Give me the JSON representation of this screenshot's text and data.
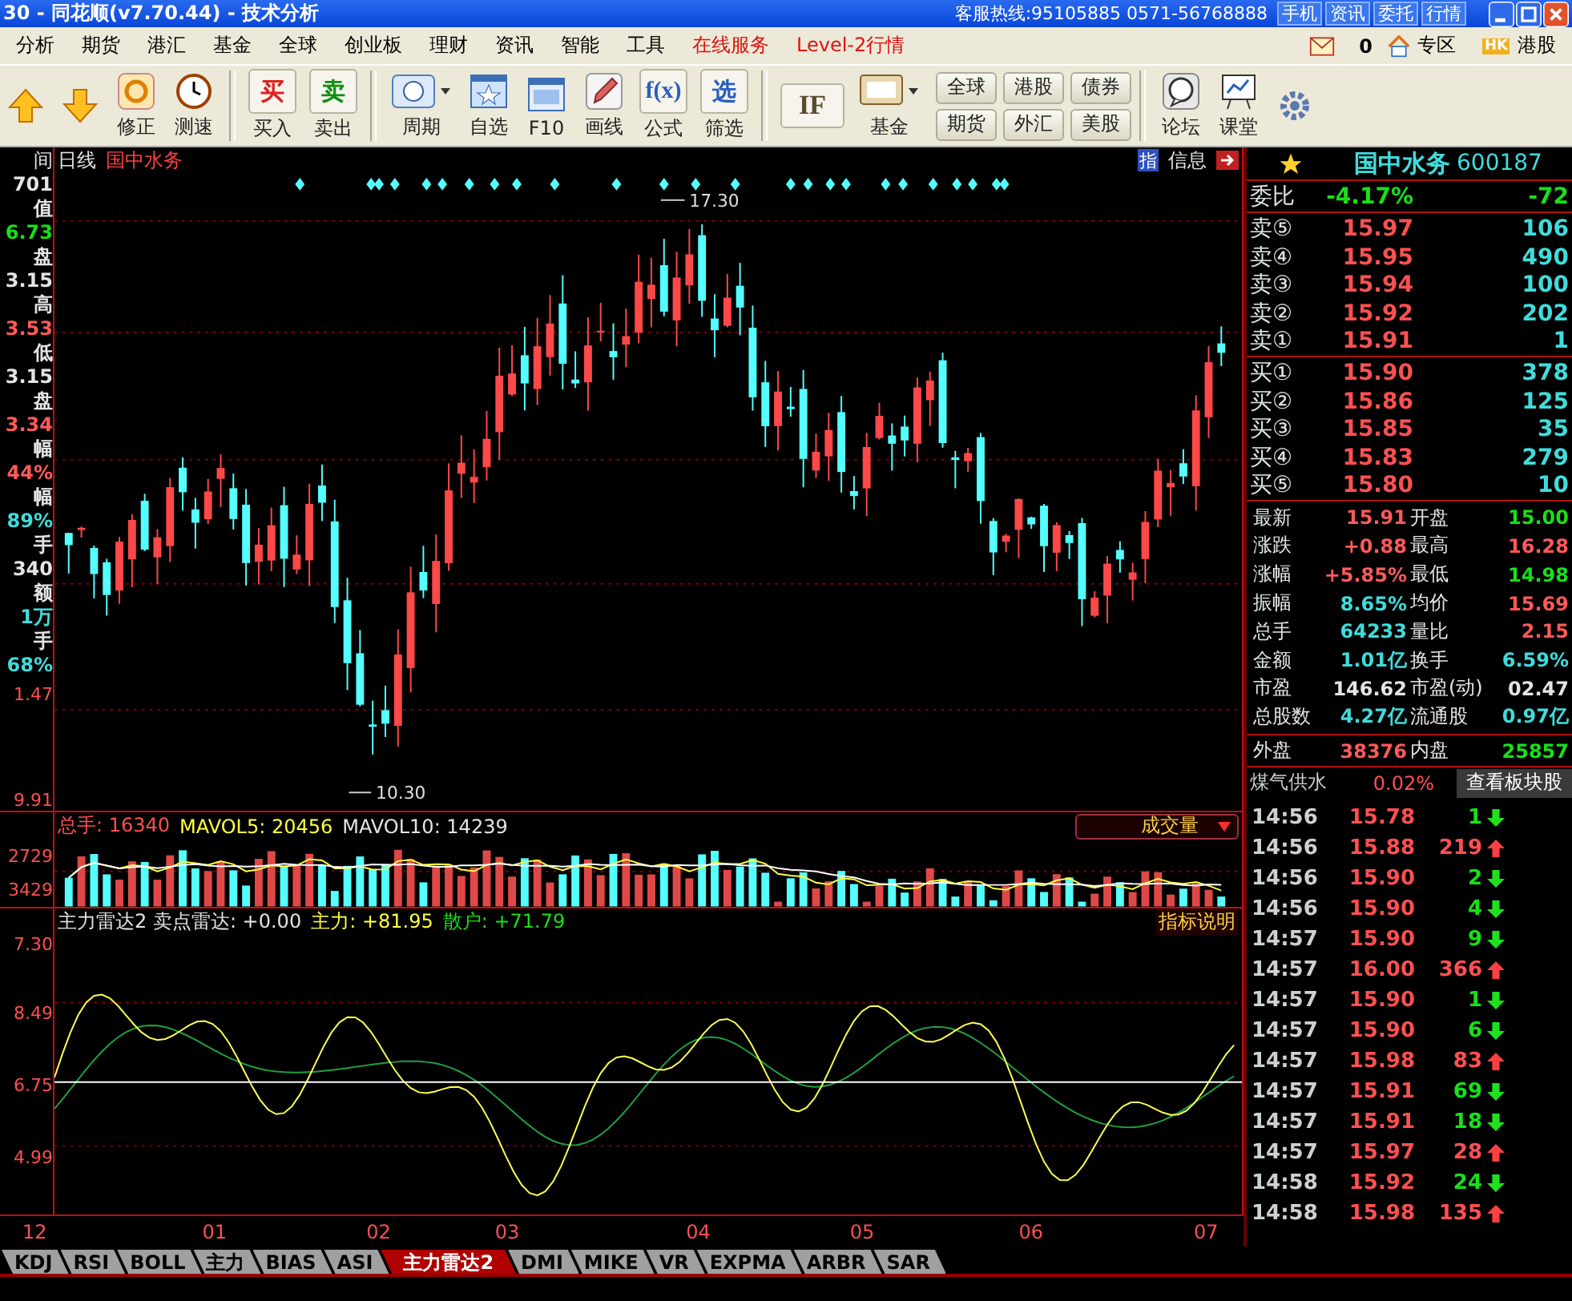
{
  "title_bar": {
    "title": "30 - 同花顺(v7.70.44) - 技术分析",
    "hotline": "客服热线:95105885 0571-56768888",
    "buttons": [
      "手机",
      "资讯",
      "委托",
      "行情"
    ]
  },
  "menu": {
    "items": [
      {
        "label": "分析",
        "kind": "normal"
      },
      {
        "label": "期货",
        "kind": "normal"
      },
      {
        "label": "港汇",
        "kind": "normal"
      },
      {
        "label": "基金",
        "kind": "normal"
      },
      {
        "label": "全球",
        "kind": "normal"
      },
      {
        "label": "创业板",
        "kind": "normal"
      },
      {
        "label": "理财",
        "kind": "normal"
      },
      {
        "label": "资讯",
        "kind": "normal"
      },
      {
        "label": "智能",
        "kind": "normal"
      },
      {
        "label": "工具",
        "kind": "normal"
      },
      {
        "label": "在线服务",
        "kind": "highlight"
      },
      {
        "label": "Level-2行情",
        "kind": "highlight"
      }
    ],
    "mail_count": "0",
    "zone": "专区",
    "hk_badge": "HK",
    "hk": "港股"
  },
  "toolbar": {
    "groups": [
      [
        {
          "kind": "arrow-up"
        },
        {
          "kind": "arrow-down"
        },
        {
          "kind": "circle",
          "label": "修正"
        },
        {
          "kind": "clock",
          "label": "测速"
        }
      ],
      [
        {
          "kind": "glyph",
          "glyph": "买",
          "color": "#e02020",
          "label": "买入"
        },
        {
          "kind": "glyph",
          "glyph": "卖",
          "color": "#109010",
          "label": "卖出"
        }
      ],
      [
        {
          "kind": "dropdown",
          "label": "周期"
        },
        {
          "kind": "star",
          "label": "自选"
        },
        {
          "kind": "window",
          "label": "F10"
        },
        {
          "kind": "pencil",
          "label": "画线"
        },
        {
          "kind": "glyph",
          "glyph": "f(x)",
          "color": "#2a5fc0",
          "label": "公式"
        },
        {
          "kind": "glyph",
          "glyph": "选",
          "color": "#2a5fc0",
          "label": "筛选"
        }
      ],
      [
        {
          "kind": "glyph",
          "glyph": "IF",
          "color": "#5a4a30"
        },
        {
          "kind": "monitor",
          "label": "基金"
        },
        {
          "kind": "pills",
          "pills": [
            "全球",
            "港股",
            "债券",
            "期货",
            "外汇",
            "美股"
          ]
        }
      ],
      [
        {
          "kind": "chat",
          "label": "论坛"
        },
        {
          "kind": "board",
          "label": "课堂"
        },
        {
          "kind": "gear"
        }
      ]
    ]
  },
  "chart_header": {
    "left": "间",
    "period": "日线",
    "stock": "国中水务",
    "buttons": [
      "指",
      "信息"
    ]
  },
  "left_panel": [
    {
      "text": "701",
      "color": "#e4e4e4"
    },
    {
      "text": "值",
      "color": "#e4e4e4"
    },
    {
      "text": "6.73",
      "color": "#18e018"
    },
    {
      "text": "盘",
      "color": "#e4e4e4"
    },
    {
      "text": "3.15",
      "color": "#e4e4e4"
    },
    {
      "text": "高",
      "color": "#e4e4e4"
    },
    {
      "text": "3.53",
      "color": "#ff5a5a"
    },
    {
      "text": "低",
      "color": "#e4e4e4"
    },
    {
      "text": "3.15",
      "color": "#e4e4e4"
    },
    {
      "text": "盘",
      "color": "#e4e4e4"
    },
    {
      "text": "3.34",
      "color": "#ff5a5a"
    },
    {
      "text": "幅",
      "color": "#e4e4e4"
    },
    {
      "text": "44%",
      "color": "#ff5a5a"
    },
    {
      "text": "幅",
      "color": "#e4e4e4"
    },
    {
      "text": "89%",
      "color": "#40dcdc"
    },
    {
      "text": "手",
      "color": "#e4e4e4"
    },
    {
      "text": "340",
      "color": "#e4e4e4"
    },
    {
      "text": "额",
      "color": "#e4e4e4"
    },
    {
      "text": "1万",
      "color": "#40dcdc"
    },
    {
      "text": "手",
      "color": "#e4e4e4"
    },
    {
      "text": "68%",
      "color": "#40dcdc"
    }
  ],
  "main_chart": {
    "axis_label": "1.47",
    "bottom_label": "9.91",
    "high_label": "17.30",
    "low_label": "10.30"
  },
  "volume": {
    "total": "总手: 16340",
    "ma5": "MAVOL5: 20456",
    "ma10": "MAVOL10: 14239",
    "dropdown": "成交量",
    "axis": [
      "2729",
      "3429"
    ]
  },
  "indicator": {
    "name": "主力雷达2 卖点雷达: +0.00",
    "main": "主力: +81.95",
    "retail": "散户: +71.79",
    "help": "指标说明",
    "axis": [
      "7.30",
      "8.49",
      "6.75",
      "4.99"
    ]
  },
  "x_axis": [
    "12",
    "01",
    "02",
    "03",
    "04",
    "05",
    "06",
    "07"
  ],
  "tabs": [
    {
      "label": "KDJ",
      "selected": false
    },
    {
      "label": "RSI",
      "selected": false
    },
    {
      "label": "BOLL",
      "selected": false
    },
    {
      "label": "主力",
      "selected": false
    },
    {
      "label": "BIAS",
      "selected": false
    },
    {
      "label": "ASI",
      "selected": false
    },
    {
      "label": "主力雷达2",
      "selected": true
    },
    {
      "label": "DMI",
      "selected": false
    },
    {
      "label": "MIKE",
      "selected": false
    },
    {
      "label": "VR",
      "selected": false
    },
    {
      "label": "EXPMA",
      "selected": false
    },
    {
      "label": "ARBR",
      "selected": false
    },
    {
      "label": "SAR",
      "selected": false
    }
  ],
  "quote": {
    "name": "国中水务",
    "code": "600187",
    "ratio": {
      "label": "委比",
      "value": "-4.17%",
      "diff": "-72"
    },
    "sells": [
      {
        "label": "卖⑤",
        "price": "15.97",
        "volume": "106"
      },
      {
        "label": "卖④",
        "price": "15.95",
        "volume": "490"
      },
      {
        "label": "卖③",
        "price": "15.94",
        "volume": "100"
      },
      {
        "label": "卖②",
        "price": "15.92",
        "volume": "202"
      },
      {
        "label": "卖①",
        "price": "15.91",
        "volume": "1"
      }
    ],
    "buys": [
      {
        "label": "买①",
        "price": "15.90",
        "volume": "378"
      },
      {
        "label": "买②",
        "price": "15.86",
        "volume": "125"
      },
      {
        "label": "买③",
        "price": "15.85",
        "volume": "35"
      },
      {
        "label": "买④",
        "price": "15.83",
        "volume": "279"
      },
      {
        "label": "买⑤",
        "price": "15.80",
        "volume": "10"
      }
    ],
    "stats": [
      [
        {
          "label": "最新",
          "value": "15.91",
          "color": "#ff5a5a"
        },
        {
          "label": "开盘",
          "value": "15.00",
          "color": "#18e018"
        }
      ],
      [
        {
          "label": "涨跌",
          "value": "+0.88",
          "color": "#ff5a5a"
        },
        {
          "label": "最高",
          "value": "16.28",
          "color": "#ff5a5a"
        }
      ],
      [
        {
          "label": "涨幅",
          "value": "+5.85%",
          "color": "#ff5a5a"
        },
        {
          "label": "最低",
          "value": "14.98",
          "color": "#18e018"
        }
      ],
      [
        {
          "label": "振幅",
          "value": "8.65%",
          "color": "#40dcdc"
        },
        {
          "label": "均价",
          "value": "15.69",
          "color": "#ff5a5a"
        }
      ],
      [
        {
          "label": "总手",
          "value": "64233",
          "color": "#40dcdc"
        },
        {
          "label": "量比",
          "value": "2.15",
          "color": "#ff5a5a"
        }
      ],
      [
        {
          "label": "金额",
          "value": "1.01亿",
          "color": "#40dcdc"
        },
        {
          "label": "换手",
          "value": "6.59%",
          "color": "#40dcdc"
        }
      ],
      [
        {
          "label": "市盈",
          "value": "146.62",
          "color": "#e4e4e4"
        },
        {
          "label": "市盈(动)",
          "value": "02.47",
          "color": "#e4e4e4"
        }
      ],
      [
        {
          "label": "总股数",
          "value": "4.27亿",
          "color": "#40dcdc"
        },
        {
          "label": "流通股",
          "value": "0.97亿",
          "color": "#40dcdc"
        }
      ]
    ],
    "outer": [
      {
        "label": "外盘",
        "value": "38376",
        "color": "#ff5a5a"
      },
      {
        "label": "内盘",
        "value": "25857",
        "color": "#18e018"
      }
    ],
    "sector": {
      "name": "煤气供水",
      "change": "0.02%",
      "button": "查看板块股"
    },
    "ticks": [
      {
        "time": "14:56",
        "price": "15.78",
        "volume": "1",
        "up": false
      },
      {
        "time": "14:56",
        "price": "15.88",
        "volume": "219",
        "up": true
      },
      {
        "time": "14:56",
        "price": "15.90",
        "volume": "2",
        "up": false
      },
      {
        "time": "14:56",
        "price": "15.90",
        "volume": "4",
        "up": false
      },
      {
        "time": "14:57",
        "price": "15.90",
        "volume": "9",
        "up": false
      },
      {
        "time": "14:57",
        "price": "16.00",
        "volume": "366",
        "up": true
      },
      {
        "time": "14:57",
        "price": "15.90",
        "volume": "1",
        "up": false
      },
      {
        "time": "14:57",
        "price": "15.90",
        "volume": "6",
        "up": false
      },
      {
        "time": "14:57",
        "price": "15.98",
        "volume": "83",
        "up": true
      },
      {
        "time": "14:57",
        "price": "15.91",
        "volume": "69",
        "up": false
      },
      {
        "time": "14:57",
        "price": "15.91",
        "volume": "18",
        "up": false
      },
      {
        "time": "14:57",
        "price": "15.97",
        "volume": "28",
        "up": true
      },
      {
        "time": "14:58",
        "price": "15.92",
        "volume": "24",
        "up": false
      },
      {
        "time": "14:58",
        "price": "15.98",
        "volume": "135",
        "up": true
      }
    ]
  }
}
